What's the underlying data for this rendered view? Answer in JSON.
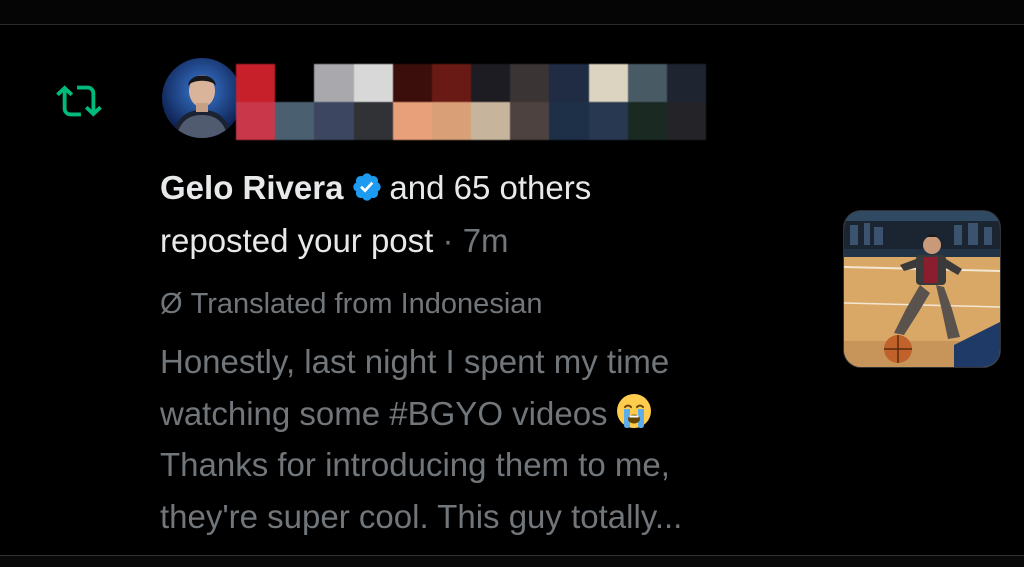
{
  "notification": {
    "type_icon": "repost-icon",
    "accent_color": "#00ba7c",
    "verified_color": "#1d9bf0",
    "name": "Gelo Rivera",
    "others_text": "and 65 others",
    "action_text": "reposted your post",
    "separator": "·",
    "time": "7m",
    "translated_prefix": "Ø",
    "translated_label": "Translated from Indonesian",
    "post_lines": [
      "Honestly, last night I spent my time",
      "watching some #BGYO videos",
      "Thanks for introducing them to me,",
      "they're super cool. This guy totally..."
    ],
    "emoji": "loudly-crying-face",
    "thumbnail": "post-image"
  }
}
